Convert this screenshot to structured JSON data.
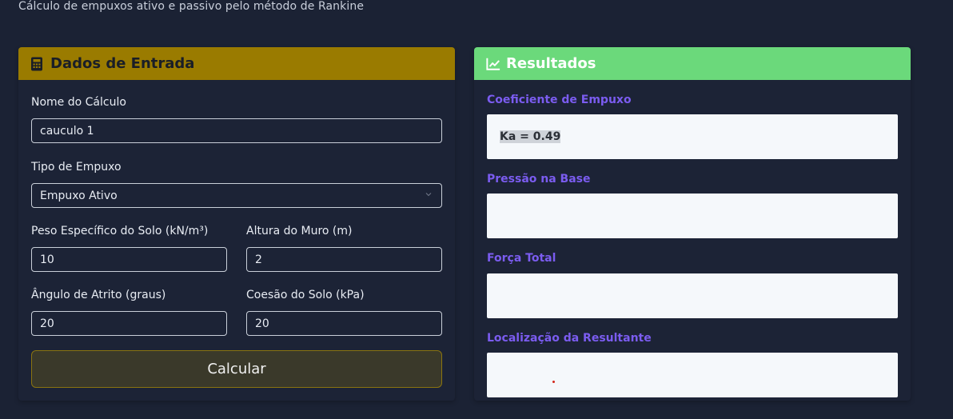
{
  "page": {
    "subtitle": "Cálculo de empuxos ativo e passivo pelo método de Rankine"
  },
  "input_card": {
    "title": "Dados de Entrada",
    "icon": "calculator-icon",
    "header_color": "#9a7b00",
    "name_label": "Nome do Cálculo",
    "name_value": "cauculo 1",
    "type_label": "Tipo de Empuxo",
    "type_value": "Empuxo Ativo",
    "weight_label": "Peso Específico do Solo (kN/m³)",
    "weight_value": "10",
    "height_label": "Altura do Muro (m)",
    "height_value": "2",
    "angle_label": "Ângulo de Atrito (graus)",
    "angle_value": "20",
    "cohesion_label": "Coesão do Solo (kPa)",
    "cohesion_value": "20",
    "calculate_label": "Calcular"
  },
  "results_card": {
    "title": "Resultados",
    "icon": "line-chart-icon",
    "header_color": "#6bd97b",
    "coef_label": "Coeficiente de Empuxo",
    "coef_value": "Ka = 0.49",
    "pressure_label": "Pressão na Base",
    "pressure_value": "",
    "force_label": "Força Total",
    "force_value": "",
    "location_label": "Localização da Resultante",
    "location_value": ""
  }
}
